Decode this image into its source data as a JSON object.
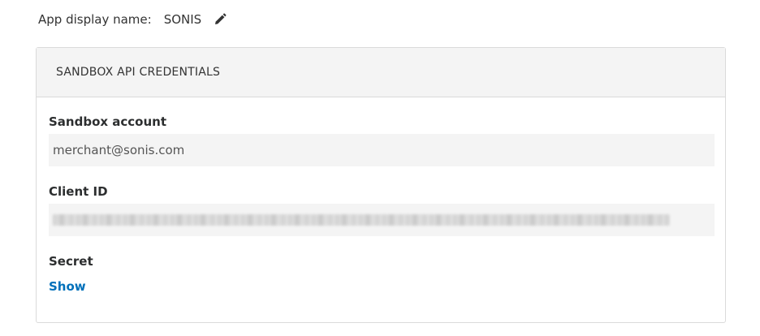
{
  "app": {
    "display_name_label": "App display name:",
    "display_name_value": "SONIS",
    "edit_icon": "pencil-icon"
  },
  "credentials_panel": {
    "title": "SANDBOX API CREDENTIALS",
    "sandbox_account": {
      "label": "Sandbox account",
      "value": "merchant@sonis.com"
    },
    "client_id": {
      "label": "Client ID",
      "value_state": "redacted"
    },
    "secret": {
      "label": "Secret",
      "show_link": "Show"
    }
  },
  "colors": {
    "link": "#0070ba",
    "field_background": "#f4f4f4",
    "header_background": "#f4f4f4",
    "border": "#dadada"
  }
}
